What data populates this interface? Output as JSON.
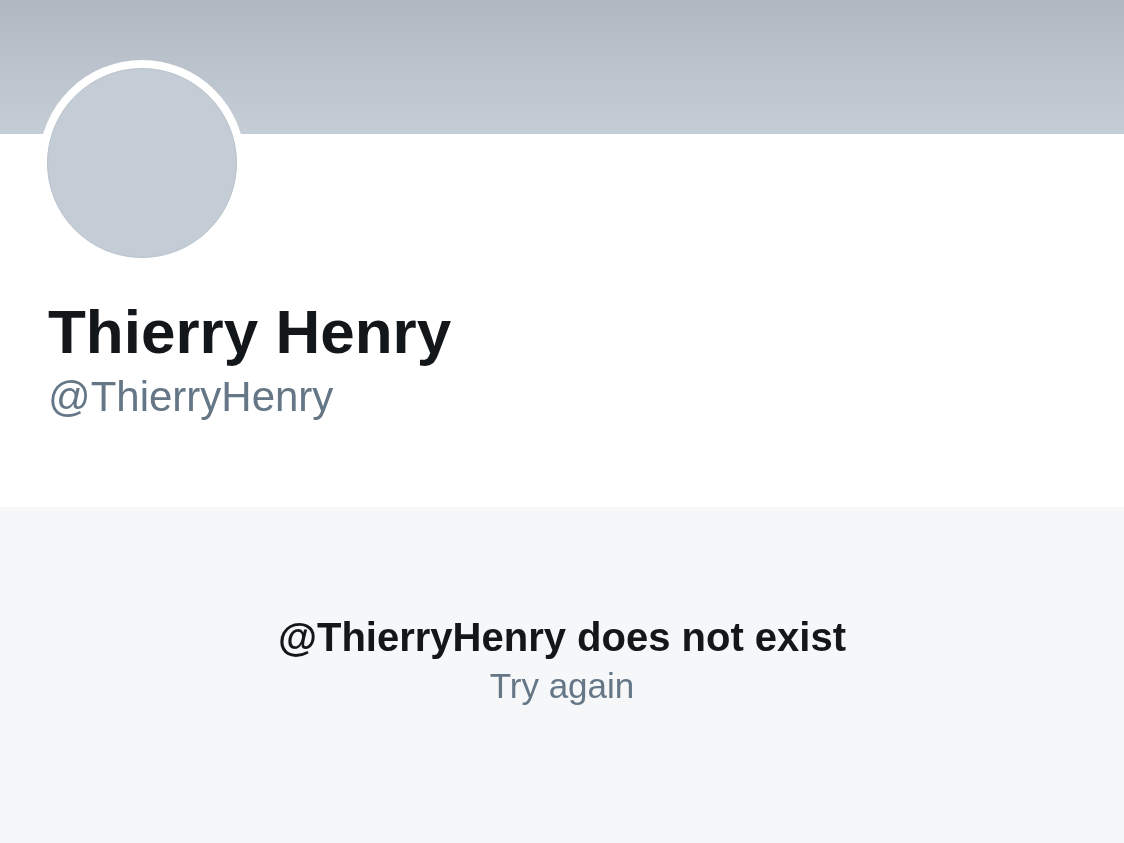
{
  "profile": {
    "name": "Thierry Henry",
    "handle": "@ThierryHenry"
  },
  "empty_state": {
    "message": "@ThierryHenry does not exist",
    "action": "Try again"
  }
}
